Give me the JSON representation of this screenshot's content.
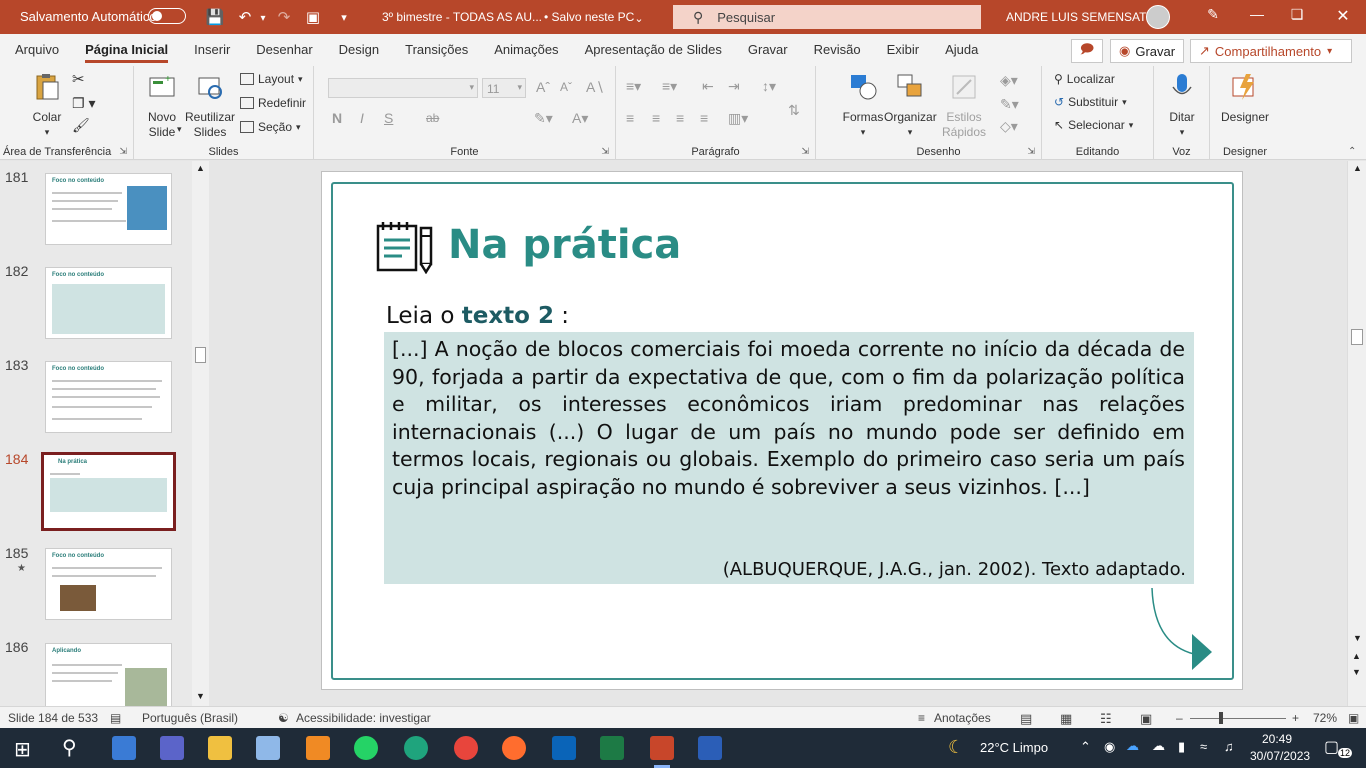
{
  "titlebar": {
    "autosave_label": "Salvamento Automático",
    "doc_title": "3º bimestre - TODAS AS AU...",
    "save_status": "• Salvo neste PC",
    "search_placeholder": "Pesquisar",
    "user_name": "ANDRE LUIS SEMENSATO"
  },
  "menu": {
    "tabs": [
      "Arquivo",
      "Página Inicial",
      "Inserir",
      "Desenhar",
      "Design",
      "Transições",
      "Animações",
      "Apresentação de Slides",
      "Gravar",
      "Revisão",
      "Exibir",
      "Ajuda"
    ],
    "active_tab": "Página Inicial",
    "record_label": "Gravar",
    "share_label": "Compartilhamento"
  },
  "ribbon": {
    "clipboard": {
      "paste": "Colar",
      "group": "Área de Transferência"
    },
    "slides": {
      "new_slide": "Novo Slide",
      "reuse": "Reutilizar Slides",
      "layout": "Layout",
      "reset": "Redefinir",
      "section": "Seção",
      "group": "Slides"
    },
    "font": {
      "size": "11",
      "bold": "N",
      "italic": "I",
      "underline": "S",
      "strike": "ab",
      "group": "Fonte"
    },
    "paragraph": {
      "group": "Parágrafo"
    },
    "drawing": {
      "shapes": "Formas",
      "arrange": "Organizar",
      "quick_styles": "Estilos Rápidos",
      "group": "Desenho"
    },
    "editing": {
      "find": "Localizar",
      "replace": "Substituir",
      "select": "Selecionar",
      "group": "Editando"
    },
    "voice": {
      "dictate": "Ditar",
      "group": "Voz"
    },
    "designer": {
      "designer": "Designer",
      "group": "Designer"
    }
  },
  "slides_panel": {
    "items": [
      {
        "num": "181",
        "title": "Foco no conteúdo"
      },
      {
        "num": "182",
        "title": "Foco no conteúdo"
      },
      {
        "num": "183",
        "title": "Foco no conteúdo"
      },
      {
        "num": "184",
        "title": "Na prática"
      },
      {
        "num": "185",
        "title": "Foco no conteúdo"
      },
      {
        "num": "186",
        "title": "Aplicando"
      }
    ],
    "active_index": 3,
    "star_marker": "★"
  },
  "slide": {
    "title": "Na prática",
    "lead_prefix": "Leia o ",
    "lead_bold": "texto 2",
    "lead_suffix": " :",
    "quote": "[...] A noção de blocos comerciais foi moeda corrente no início da década de 90, forjada a partir da expectativa de que, com o fim da polarização política e militar, os interesses econômicos iriam predominar nas relações internacionais (...) O lugar de um país no mundo pode ser definido em termos locais, regionais ou globais. Exemplo do primeiro caso seria um país cuja principal aspiração no mundo é sobreviver a seus vizinhos. [...]",
    "source": "(ALBUQUERQUE, J.A.G., jan. 2002). Texto adaptado.",
    "accent_color": "#2a8c85"
  },
  "statusbar": {
    "slide_count": "Slide 184 de 533",
    "language": "Português (Brasil)",
    "accessibility": "Acessibilidade: investigar",
    "notes": "Anotações",
    "zoom": "72%"
  },
  "taskbar": {
    "weather": "22°C  Limpo",
    "time": "20:49",
    "date": "30/07/2023",
    "notifications": "12"
  }
}
